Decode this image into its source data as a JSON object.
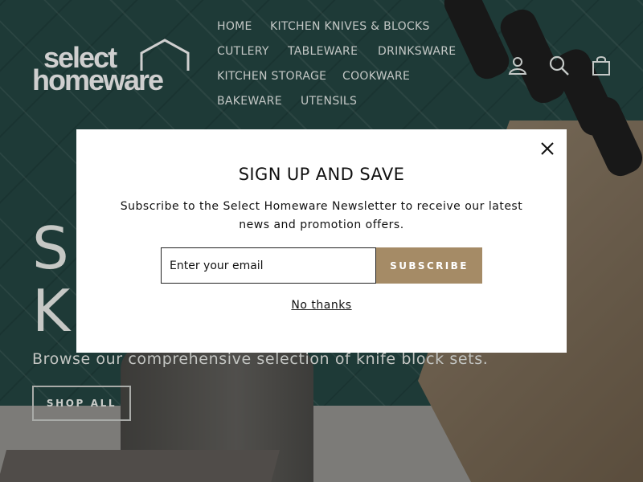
{
  "brand": {
    "logo_line1": "select",
    "logo_line2": "homeware"
  },
  "nav": {
    "items": [
      {
        "label": "HOME"
      },
      {
        "label": "KITCHEN KNIVES & BLOCKS"
      },
      {
        "label": "CUTLERY"
      },
      {
        "label": "TABLEWARE"
      },
      {
        "label": "DRINKSWARE"
      },
      {
        "label": "KITCHEN STORAGE"
      },
      {
        "label": "COOKWARE"
      },
      {
        "label": "BAKEWARE"
      },
      {
        "label": "UTENSILS"
      }
    ]
  },
  "header_icons": [
    "user-icon",
    "search-icon",
    "cart-icon"
  ],
  "hero": {
    "title": "S\nK",
    "subtitle": "Browse our comprehensive selection of knife block sets.",
    "cta": "SHOP ALL"
  },
  "modal": {
    "title": "SIGN UP AND SAVE",
    "text": "Subscribe to the Select Homeware Newsletter to receive our latest news and promotion offers.",
    "email_placeholder": "Enter your email",
    "email_value": "",
    "subscribe_label": "SUBSCRIBE",
    "dismiss_label": "No thanks"
  },
  "colors": {
    "accent": "#a58b66",
    "overlay_tile": "#2e5a55"
  }
}
